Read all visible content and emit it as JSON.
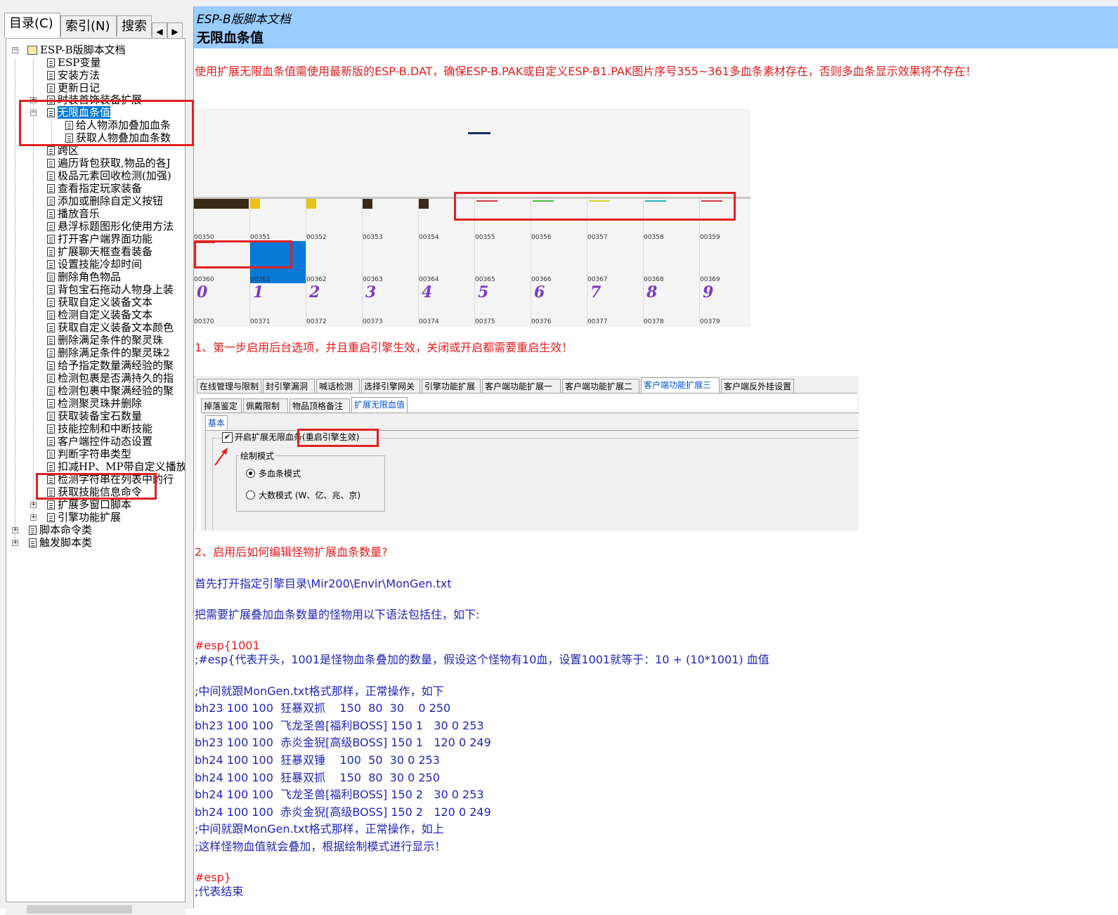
{
  "left_tabs": {
    "contents": "目录(C)",
    "index": "索引(N)",
    "search": "搜索"
  },
  "tree": [
    {
      "label": "ESP-B版脚本文档"
    },
    {
      "label": "ESP变量"
    },
    {
      "label": "安装方法"
    },
    {
      "label": "更新日记"
    },
    {
      "label": "时装首饰装备扩展"
    },
    {
      "label": "无限血条值"
    },
    {
      "label": "给人物添加叠加血条"
    },
    {
      "label": "获取人物叠加血条数"
    },
    {
      "label": "跨区"
    },
    {
      "label": "遍历背包获取,物品的各J"
    },
    {
      "label": "极品元素回收检测(加强)"
    },
    {
      "label": "查看指定玩家装备"
    },
    {
      "label": "添加或删除自定义按钮"
    },
    {
      "label": "播放音乐"
    },
    {
      "label": "悬浮标题图形化使用方法"
    },
    {
      "label": "打开客户端界面功能"
    },
    {
      "label": "扩展聊天框查看装备"
    },
    {
      "label": "设置技能冷却时间"
    },
    {
      "label": "删除角色物品"
    },
    {
      "label": "背包宝石拖动人物身上装"
    },
    {
      "label": "获取自定义装备文本"
    },
    {
      "label": "检测自定义装备文本"
    },
    {
      "label": "获取自定义装备文本颜色"
    },
    {
      "label": "删除满足条件的聚灵珠"
    },
    {
      "label": "删除满足条件的聚灵珠2"
    },
    {
      "label": "给予指定数量满经验的聚"
    },
    {
      "label": "检测包裹是否满持久的指"
    },
    {
      "label": "检测包裹中聚满经验的聚"
    },
    {
      "label": "检测聚灵珠并删除"
    },
    {
      "label": "获取装备宝石数量"
    },
    {
      "label": "技能控制和中断技能"
    },
    {
      "label": "客户端控件动态设置"
    },
    {
      "label": "判断字符串类型"
    },
    {
      "label": "扣减HP、MP带自定义播放"
    },
    {
      "label": "检测字符串在列表中的行"
    },
    {
      "label": "获取技能信息命令"
    },
    {
      "label": "扩展多窗口脚本"
    },
    {
      "label": "引擎功能扩展"
    },
    {
      "label": "脚本命令类"
    },
    {
      "label": "触发脚本类"
    }
  ],
  "header": {
    "subtitle": "ESP-B版脚本文档",
    "title": "无限血条值"
  },
  "content": {
    "notice": "使用扩展无限血条值需使用最新版的ESP-B.DAT，确保ESP-B.PAK或自定义ESP-B1.PAK图片序号355~361多血条素材存在，否则多血条显示效果将不存在！",
    "step1": "1、第一步启用后台选项，并且重启引擎生效，关闭或开启都需要重启生效！",
    "step2": "2、启用后如何编辑怪物扩展血条数量?",
    "line_open": "首先打开指定引擎目录\\Mir200\\Envir\\MonGen.txt",
    "line_wrap": "把需要扩展叠加血条数量的怪物用以下语法包括住，如下:",
    "code_start": "#esp{1001",
    "code_comment": ";#esp{代表开头，1001是怪物血条叠加的数量，假设这个怪物有10血，设置1001就等于：10 + (10*1001) 血值",
    "code_mid": ";中间就跟MonGen.txt格式那样，正常操作，如下",
    "code_lines": [
      "bh23 100 100  狂暴双抓    150  80  30    0 250",
      "bh23 100 100  飞龙圣兽[福利BOSS] 150 1   30 0 253",
      "bh23 100 100  赤炎金猊[高级BOSS] 150 1   120 0 249",
      "bh24 100 100  狂暴双锤    100  50  30 0 253",
      "bh24 100 100  狂暴双抓    150  80  30 0 250",
      "bh24 100 100  飞龙圣兽[福利BOSS] 150 2   30 0 253",
      "bh24 100 100  赤炎金猊[高级BOSS] 150 2   120 0 249"
    ],
    "code_mid2": ";中间就跟MonGen.txt格式那样，正常操作，如上",
    "code_result": ";这样怪物血值就会叠加，根据绘制模式进行显示！",
    "code_end": "#esp}",
    "code_end_comment": ";代表结束"
  },
  "sprite": {
    "row1": [
      "00350",
      "00351",
      "00352",
      "00353",
      "00354",
      "00355",
      "00356",
      "00357",
      "00358",
      "00359"
    ],
    "row2": [
      "00360",
      "00361",
      "00362",
      "00363",
      "00364",
      "00365",
      "00366",
      "00367",
      "00368",
      "00369"
    ],
    "row3": [
      "00370",
      "00371",
      "00372",
      "00373",
      "00374",
      "00375",
      "00376",
      "00377",
      "00378",
      "00379"
    ],
    "digits": [
      "0",
      "1",
      "2",
      "3",
      "4",
      "5",
      "6",
      "7",
      "8",
      "9"
    ],
    "bar_colors": [
      "#d43a3a",
      "#3fbf3f",
      "#d9d12a",
      "#2bb3b3",
      "#d43a3a"
    ]
  },
  "settings": {
    "tabs": [
      "在线管理与限制",
      "封引擎漏洞",
      "喊话检测",
      "选择引擎网关",
      "引擎功能扩展",
      "客户端功能扩展一",
      "客户端功能扩展二",
      "客户端功能扩展三",
      "客户端反外挂设置"
    ],
    "subtabs": [
      "掉落鉴定",
      "佩戴限制",
      "物品顶格备注",
      "扩展无限血值"
    ],
    "basic_tab": "基本",
    "checkbox_label": "开启扩展无限血条",
    "checkbox_note": "(重启引擎生效)",
    "group_title": "绘制模式",
    "radio1": "多血条模式",
    "radio2": "大数模式 (W、亿、兆、京)"
  }
}
